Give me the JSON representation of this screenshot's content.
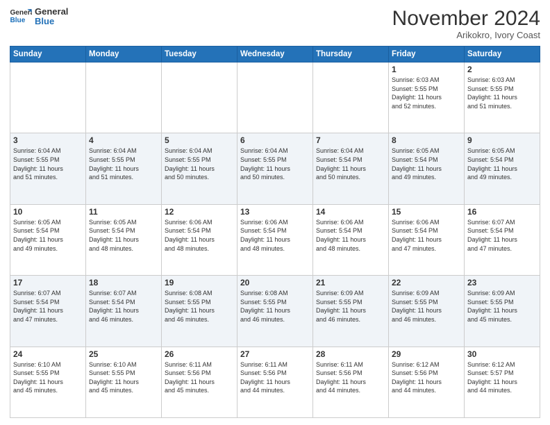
{
  "logo": {
    "line1": "General",
    "line2": "Blue"
  },
  "title": "November 2024",
  "location": "Arikokro, Ivory Coast",
  "days_of_week": [
    "Sunday",
    "Monday",
    "Tuesday",
    "Wednesday",
    "Thursday",
    "Friday",
    "Saturday"
  ],
  "weeks": [
    [
      {
        "day": "",
        "info": ""
      },
      {
        "day": "",
        "info": ""
      },
      {
        "day": "",
        "info": ""
      },
      {
        "day": "",
        "info": ""
      },
      {
        "day": "",
        "info": ""
      },
      {
        "day": "1",
        "info": "Sunrise: 6:03 AM\nSunset: 5:55 PM\nDaylight: 11 hours\nand 52 minutes."
      },
      {
        "day": "2",
        "info": "Sunrise: 6:03 AM\nSunset: 5:55 PM\nDaylight: 11 hours\nand 51 minutes."
      }
    ],
    [
      {
        "day": "3",
        "info": "Sunrise: 6:04 AM\nSunset: 5:55 PM\nDaylight: 11 hours\nand 51 minutes."
      },
      {
        "day": "4",
        "info": "Sunrise: 6:04 AM\nSunset: 5:55 PM\nDaylight: 11 hours\nand 51 minutes."
      },
      {
        "day": "5",
        "info": "Sunrise: 6:04 AM\nSunset: 5:55 PM\nDaylight: 11 hours\nand 50 minutes."
      },
      {
        "day": "6",
        "info": "Sunrise: 6:04 AM\nSunset: 5:55 PM\nDaylight: 11 hours\nand 50 minutes."
      },
      {
        "day": "7",
        "info": "Sunrise: 6:04 AM\nSunset: 5:54 PM\nDaylight: 11 hours\nand 50 minutes."
      },
      {
        "day": "8",
        "info": "Sunrise: 6:05 AM\nSunset: 5:54 PM\nDaylight: 11 hours\nand 49 minutes."
      },
      {
        "day": "9",
        "info": "Sunrise: 6:05 AM\nSunset: 5:54 PM\nDaylight: 11 hours\nand 49 minutes."
      }
    ],
    [
      {
        "day": "10",
        "info": "Sunrise: 6:05 AM\nSunset: 5:54 PM\nDaylight: 11 hours\nand 49 minutes."
      },
      {
        "day": "11",
        "info": "Sunrise: 6:05 AM\nSunset: 5:54 PM\nDaylight: 11 hours\nand 48 minutes."
      },
      {
        "day": "12",
        "info": "Sunrise: 6:06 AM\nSunset: 5:54 PM\nDaylight: 11 hours\nand 48 minutes."
      },
      {
        "day": "13",
        "info": "Sunrise: 6:06 AM\nSunset: 5:54 PM\nDaylight: 11 hours\nand 48 minutes."
      },
      {
        "day": "14",
        "info": "Sunrise: 6:06 AM\nSunset: 5:54 PM\nDaylight: 11 hours\nand 48 minutes."
      },
      {
        "day": "15",
        "info": "Sunrise: 6:06 AM\nSunset: 5:54 PM\nDaylight: 11 hours\nand 47 minutes."
      },
      {
        "day": "16",
        "info": "Sunrise: 6:07 AM\nSunset: 5:54 PM\nDaylight: 11 hours\nand 47 minutes."
      }
    ],
    [
      {
        "day": "17",
        "info": "Sunrise: 6:07 AM\nSunset: 5:54 PM\nDaylight: 11 hours\nand 47 minutes."
      },
      {
        "day": "18",
        "info": "Sunrise: 6:07 AM\nSunset: 5:54 PM\nDaylight: 11 hours\nand 46 minutes."
      },
      {
        "day": "19",
        "info": "Sunrise: 6:08 AM\nSunset: 5:55 PM\nDaylight: 11 hours\nand 46 minutes."
      },
      {
        "day": "20",
        "info": "Sunrise: 6:08 AM\nSunset: 5:55 PM\nDaylight: 11 hours\nand 46 minutes."
      },
      {
        "day": "21",
        "info": "Sunrise: 6:09 AM\nSunset: 5:55 PM\nDaylight: 11 hours\nand 46 minutes."
      },
      {
        "day": "22",
        "info": "Sunrise: 6:09 AM\nSunset: 5:55 PM\nDaylight: 11 hours\nand 46 minutes."
      },
      {
        "day": "23",
        "info": "Sunrise: 6:09 AM\nSunset: 5:55 PM\nDaylight: 11 hours\nand 45 minutes."
      }
    ],
    [
      {
        "day": "24",
        "info": "Sunrise: 6:10 AM\nSunset: 5:55 PM\nDaylight: 11 hours\nand 45 minutes."
      },
      {
        "day": "25",
        "info": "Sunrise: 6:10 AM\nSunset: 5:55 PM\nDaylight: 11 hours\nand 45 minutes."
      },
      {
        "day": "26",
        "info": "Sunrise: 6:11 AM\nSunset: 5:56 PM\nDaylight: 11 hours\nand 45 minutes."
      },
      {
        "day": "27",
        "info": "Sunrise: 6:11 AM\nSunset: 5:56 PM\nDaylight: 11 hours\nand 44 minutes."
      },
      {
        "day": "28",
        "info": "Sunrise: 6:11 AM\nSunset: 5:56 PM\nDaylight: 11 hours\nand 44 minutes."
      },
      {
        "day": "29",
        "info": "Sunrise: 6:12 AM\nSunset: 5:56 PM\nDaylight: 11 hours\nand 44 minutes."
      },
      {
        "day": "30",
        "info": "Sunrise: 6:12 AM\nSunset: 5:57 PM\nDaylight: 11 hours\nand 44 minutes."
      }
    ]
  ]
}
